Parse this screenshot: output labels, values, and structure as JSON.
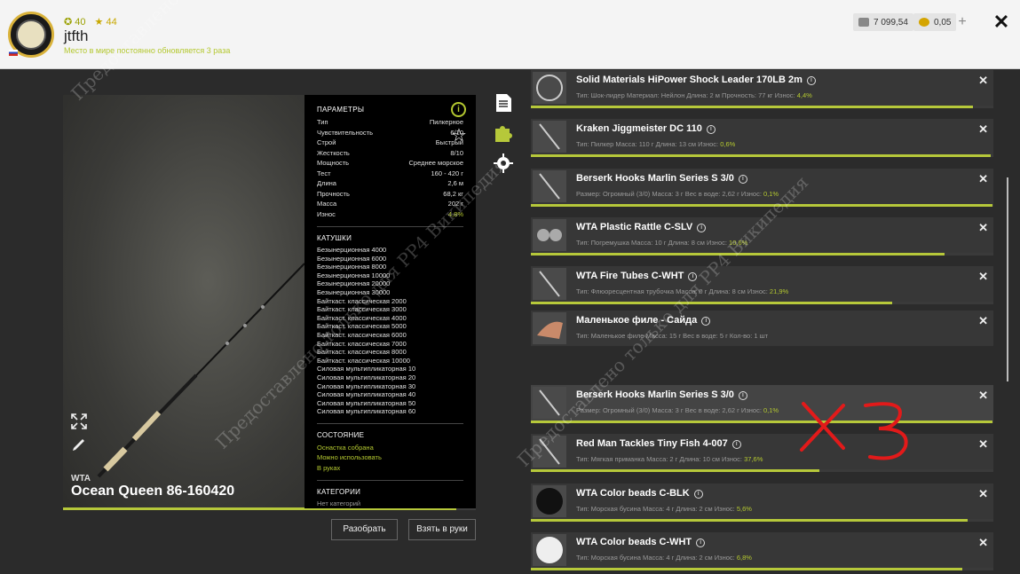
{
  "player": {
    "level": "40",
    "rank": "44",
    "name": "jtfth",
    "subtitle": "Место в мире постоянно обновляется 3 раза"
  },
  "currency": {
    "silver": "7 099,54",
    "gold": "0,05"
  },
  "rod": {
    "brand": "WTA",
    "name": "Ocean Queen 86-160420",
    "wear_fraction": 0.952,
    "params_title": "ПАРАМЕТРЫ",
    "params": [
      {
        "k": "Тип",
        "v": "Пилкерное"
      },
      {
        "k": "Чувствительность",
        "v": "6/10"
      },
      {
        "k": "Строй",
        "v": "Быстрый"
      },
      {
        "k": "Жесткость",
        "v": "8/10"
      },
      {
        "k": "Мощность",
        "v": "Среднее морское"
      },
      {
        "k": "Тест",
        "v": "160 - 420 г"
      },
      {
        "k": "Длина",
        "v": "2,6 м"
      },
      {
        "k": "Прочность",
        "v": "68,2 кг"
      },
      {
        "k": "Масса",
        "v": "202 г"
      },
      {
        "k": "Износ",
        "v": "4,8%"
      }
    ],
    "reels_title": "КАТУШКИ",
    "reels": [
      "Безынерционная 4000",
      "Безынерционная 6000",
      "Безынерционная 8000",
      "Безынерционная 10000",
      "Безынерционная 20000",
      "Безынерционная 30000",
      "Байткаст. классическая 2000",
      "Байткаст. классическая 3000",
      "Байткаст. классическая 4000",
      "Байткаст. классическая 5000",
      "Байткаст. классическая 6000",
      "Байткаст. классическая 7000",
      "Байткаст. классическая 8000",
      "Байткаст. классическая 10000",
      "Силовая мультипликаторная 10",
      "Силовая мультипликаторная 20",
      "Силовая мультипликаторная 30",
      "Силовая мультипликаторная 40",
      "Силовая мультипликаторная 50",
      "Силовая мультипликаторная 60"
    ],
    "state_title": "СОСТОЯНИЕ",
    "state": [
      "Оснастка собрана",
      "Можно использовать",
      "В руках"
    ],
    "categories_title": "КАТЕГОРИИ",
    "categories": "Нет категорий"
  },
  "buttons": {
    "disassemble": "Разобрать",
    "take": "Взять в руки"
  },
  "items": [
    {
      "name": "Solid Materials HiPower Shock Leader 170LB 2m",
      "desc": "Тип: Шок-лидер  Материал: Нейлон  Длина: 2 м  Прочность: 77 кг  Износ:",
      "wear": "4,4%",
      "bar": 0.956
    },
    {
      "name": "Kraken Jiggmeister DC 110",
      "desc": "Тип: Пилкер  Масса: 110 г  Длина: 13 см  Износ:",
      "wear": "0,6%",
      "bar": 0.994
    },
    {
      "name": "Berserk Hooks Marlin Series S 3/0",
      "desc": "Размер: Огромный (3/0)  Масса: 3 г  Вес в воде: 2,62 г  Износ:",
      "wear": "0,1%",
      "bar": 0.999
    },
    {
      "name": "WTA Plastic Rattle C-SLV",
      "desc": "Тип: Погремушка  Масса: 10 г  Длина: 8 см  Износ:",
      "wear": "10,6%",
      "bar": 0.894
    },
    {
      "name": "WTA Fire Tubes C-WHT",
      "desc": "Тип: Флюоресцентная трубочка  Масса: 0 г  Длина: 8 см  Износ:",
      "wear": "21,9%",
      "bar": 0.781
    },
    {
      "name": "Маленькое филе - Сайда",
      "desc": "Тип: Маленькое филе  Масса: 15 г  Вес в воде: 5 г  Кол-во: 1 шт",
      "wear": "",
      "bar": 0
    },
    {
      "name": "Berserk Hooks Marlin Series S 3/0",
      "desc": "Размер: Огромный (3/0)  Масса: 3 г  Вес в воде: 2,62 г  Износ:",
      "wear": "0,1%",
      "bar": 0.999
    },
    {
      "name": "Red Man Tackles Tiny Fish 4-007",
      "desc": "Тип: Мягкая приманка  Масса: 2 г  Длина: 10 см  Износ:",
      "wear": "37,6%",
      "bar": 0.624
    },
    {
      "name": "WTA Color beads C-BLK",
      "desc": "Тип: Морская бусина  Масса: 4 г  Длина: 2 см  Износ:",
      "wear": "5,6%",
      "bar": 0.944
    },
    {
      "name": "WTA Color beads C-WHT",
      "desc": "Тип: Морская бусина  Масса: 4 г  Длина: 2 см  Износ:",
      "wear": "6,8%",
      "bar": 0.932
    }
  ],
  "watermark": "Предоставлено только для РР4 Википедия",
  "annotation": "x3",
  "colors": {
    "accent": "#b6c83a",
    "panel": "#373737",
    "bg": "#2b2b2b"
  }
}
